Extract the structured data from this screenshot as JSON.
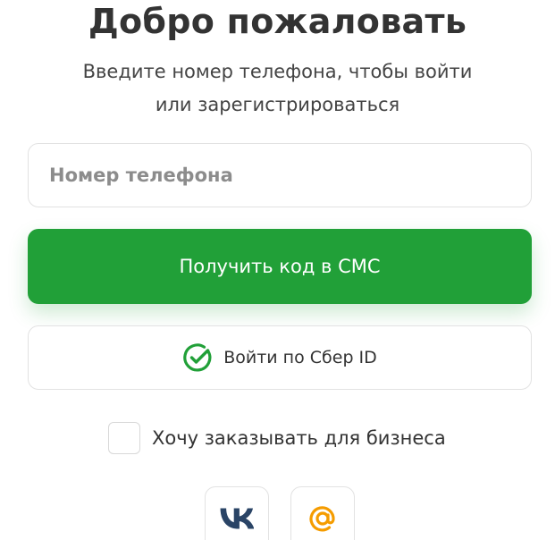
{
  "title": "Добро пожаловать",
  "subtitle": {
    "line1": "Введите номер телефона, чтобы войти",
    "line2": "или зарегистрироваться"
  },
  "phone_input": {
    "placeholder": "Номер телефона",
    "value": ""
  },
  "sms_button": {
    "label": "Получить код в СМС"
  },
  "sber_button": {
    "label": "Войти по Сбер ID",
    "icon": "sber-check-icon"
  },
  "business_checkbox": {
    "label": "Хочу заказывать для бизнеса",
    "checked": false
  },
  "social": [
    {
      "name": "vk-icon"
    },
    {
      "name": "mail-at-icon"
    }
  ],
  "colors": {
    "accent": "#21a038",
    "vk": "#2a4466",
    "mail": "#f59c00",
    "border": "#e2e2e2"
  }
}
